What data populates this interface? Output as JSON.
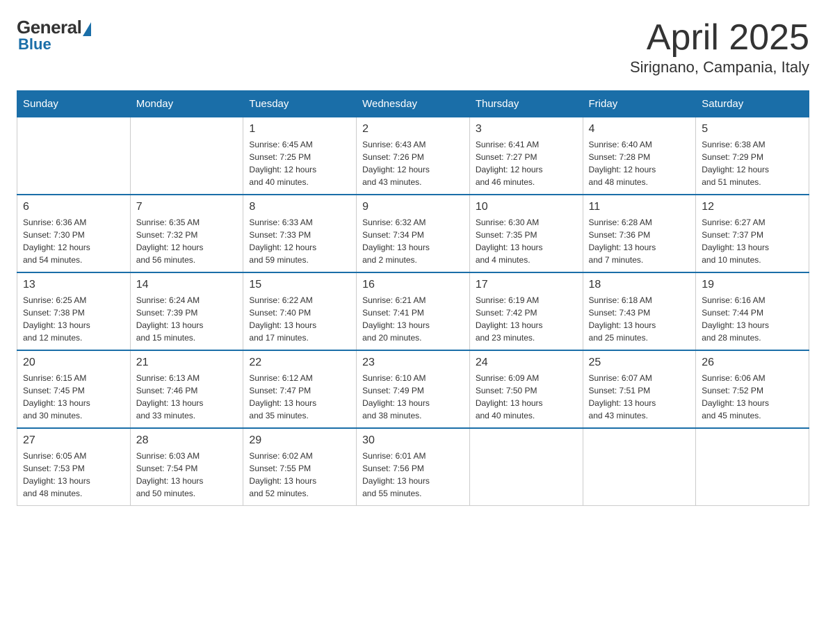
{
  "header": {
    "logo_general": "General",
    "logo_blue": "Blue",
    "month_title": "April 2025",
    "location": "Sirignano, Campania, Italy"
  },
  "weekdays": [
    "Sunday",
    "Monday",
    "Tuesday",
    "Wednesday",
    "Thursday",
    "Friday",
    "Saturday"
  ],
  "weeks": [
    [
      {
        "day": "",
        "info": ""
      },
      {
        "day": "",
        "info": ""
      },
      {
        "day": "1",
        "info": "Sunrise: 6:45 AM\nSunset: 7:25 PM\nDaylight: 12 hours\nand 40 minutes."
      },
      {
        "day": "2",
        "info": "Sunrise: 6:43 AM\nSunset: 7:26 PM\nDaylight: 12 hours\nand 43 minutes."
      },
      {
        "day": "3",
        "info": "Sunrise: 6:41 AM\nSunset: 7:27 PM\nDaylight: 12 hours\nand 46 minutes."
      },
      {
        "day": "4",
        "info": "Sunrise: 6:40 AM\nSunset: 7:28 PM\nDaylight: 12 hours\nand 48 minutes."
      },
      {
        "day": "5",
        "info": "Sunrise: 6:38 AM\nSunset: 7:29 PM\nDaylight: 12 hours\nand 51 minutes."
      }
    ],
    [
      {
        "day": "6",
        "info": "Sunrise: 6:36 AM\nSunset: 7:30 PM\nDaylight: 12 hours\nand 54 minutes."
      },
      {
        "day": "7",
        "info": "Sunrise: 6:35 AM\nSunset: 7:32 PM\nDaylight: 12 hours\nand 56 minutes."
      },
      {
        "day": "8",
        "info": "Sunrise: 6:33 AM\nSunset: 7:33 PM\nDaylight: 12 hours\nand 59 minutes."
      },
      {
        "day": "9",
        "info": "Sunrise: 6:32 AM\nSunset: 7:34 PM\nDaylight: 13 hours\nand 2 minutes."
      },
      {
        "day": "10",
        "info": "Sunrise: 6:30 AM\nSunset: 7:35 PM\nDaylight: 13 hours\nand 4 minutes."
      },
      {
        "day": "11",
        "info": "Sunrise: 6:28 AM\nSunset: 7:36 PM\nDaylight: 13 hours\nand 7 minutes."
      },
      {
        "day": "12",
        "info": "Sunrise: 6:27 AM\nSunset: 7:37 PM\nDaylight: 13 hours\nand 10 minutes."
      }
    ],
    [
      {
        "day": "13",
        "info": "Sunrise: 6:25 AM\nSunset: 7:38 PM\nDaylight: 13 hours\nand 12 minutes."
      },
      {
        "day": "14",
        "info": "Sunrise: 6:24 AM\nSunset: 7:39 PM\nDaylight: 13 hours\nand 15 minutes."
      },
      {
        "day": "15",
        "info": "Sunrise: 6:22 AM\nSunset: 7:40 PM\nDaylight: 13 hours\nand 17 minutes."
      },
      {
        "day": "16",
        "info": "Sunrise: 6:21 AM\nSunset: 7:41 PM\nDaylight: 13 hours\nand 20 minutes."
      },
      {
        "day": "17",
        "info": "Sunrise: 6:19 AM\nSunset: 7:42 PM\nDaylight: 13 hours\nand 23 minutes."
      },
      {
        "day": "18",
        "info": "Sunrise: 6:18 AM\nSunset: 7:43 PM\nDaylight: 13 hours\nand 25 minutes."
      },
      {
        "day": "19",
        "info": "Sunrise: 6:16 AM\nSunset: 7:44 PM\nDaylight: 13 hours\nand 28 minutes."
      }
    ],
    [
      {
        "day": "20",
        "info": "Sunrise: 6:15 AM\nSunset: 7:45 PM\nDaylight: 13 hours\nand 30 minutes."
      },
      {
        "day": "21",
        "info": "Sunrise: 6:13 AM\nSunset: 7:46 PM\nDaylight: 13 hours\nand 33 minutes."
      },
      {
        "day": "22",
        "info": "Sunrise: 6:12 AM\nSunset: 7:47 PM\nDaylight: 13 hours\nand 35 minutes."
      },
      {
        "day": "23",
        "info": "Sunrise: 6:10 AM\nSunset: 7:49 PM\nDaylight: 13 hours\nand 38 minutes."
      },
      {
        "day": "24",
        "info": "Sunrise: 6:09 AM\nSunset: 7:50 PM\nDaylight: 13 hours\nand 40 minutes."
      },
      {
        "day": "25",
        "info": "Sunrise: 6:07 AM\nSunset: 7:51 PM\nDaylight: 13 hours\nand 43 minutes."
      },
      {
        "day": "26",
        "info": "Sunrise: 6:06 AM\nSunset: 7:52 PM\nDaylight: 13 hours\nand 45 minutes."
      }
    ],
    [
      {
        "day": "27",
        "info": "Sunrise: 6:05 AM\nSunset: 7:53 PM\nDaylight: 13 hours\nand 48 minutes."
      },
      {
        "day": "28",
        "info": "Sunrise: 6:03 AM\nSunset: 7:54 PM\nDaylight: 13 hours\nand 50 minutes."
      },
      {
        "day": "29",
        "info": "Sunrise: 6:02 AM\nSunset: 7:55 PM\nDaylight: 13 hours\nand 52 minutes."
      },
      {
        "day": "30",
        "info": "Sunrise: 6:01 AM\nSunset: 7:56 PM\nDaylight: 13 hours\nand 55 minutes."
      },
      {
        "day": "",
        "info": ""
      },
      {
        "day": "",
        "info": ""
      },
      {
        "day": "",
        "info": ""
      }
    ]
  ]
}
